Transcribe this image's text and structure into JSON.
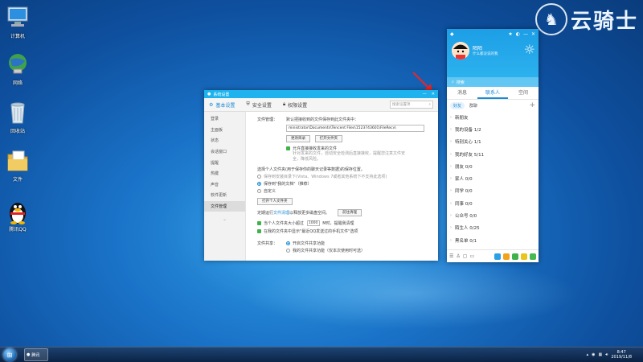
{
  "desktop": {
    "icons": [
      {
        "label": "计算机",
        "icon": "computer-icon"
      },
      {
        "label": "网络",
        "icon": "network-icon"
      },
      {
        "label": "回收站",
        "icon": "recycle-bin-icon"
      },
      {
        "label": "文件",
        "icon": "folder-icon"
      },
      {
        "label": "腾讯QQ",
        "icon": "qq-penguin-icon"
      }
    ]
  },
  "watermark": {
    "text": "云骑士"
  },
  "settings_window": {
    "title": "系统设置",
    "tabs": [
      {
        "label": "基本设置",
        "icon": "gear-icon"
      },
      {
        "label": "安全设置",
        "icon": "shield-icon"
      },
      {
        "label": "权限设置",
        "icon": "lock-icon"
      }
    ],
    "search_placeholder": "搜索设置项",
    "sidebar": [
      "登录",
      "主面板",
      "状态",
      "会话窗口",
      "提醒",
      "热键",
      "声音",
      "软件更新",
      "文件管理"
    ],
    "sidebar_active_index": 8,
    "file_mgmt": {
      "section_label": "文件管理：",
      "save_prompt": "默认把接收到的文件保存到此文件夹中：",
      "path": "ministrator\\Documents\\Tencent Files\\1523743601\\FileRecv\\",
      "btn_change": "更改目录",
      "btn_open": "打开文件夹",
      "auto_download_label": "允许直接接收发来的文件",
      "auto_download_desc": "针对发来的文件，自动安全检测后直接接收，提醒您注意文件安全，降低风险。",
      "location_prompt": "选择个人文件夹(用于保存你的聊天记录等数据)的保存位置。",
      "option_install_dir": "保存到安装目录下(Vista、Windows 7或者其他系统下不支持此选项)",
      "option_my_docs": "保存到\"我的文档\"（推荐）",
      "option_custom": "自定义",
      "btn_open_personal": "打开个人文件夹",
      "cleanup_prompt_before": "定期运行",
      "cleanup_link": "文件清理",
      "cleanup_prompt_after": "以释放更多磁盘空间。",
      "btn_cleanup": "前往清理",
      "size_check_before": "当个人文件夹大小超过",
      "size_value": "1000",
      "size_check_after": "M时，提醒我清理",
      "recent_label": "在我的文件夹中显示\"最近QQ发送过的手机文件\"选项"
    },
    "file_share": {
      "section_label": "文件共享：",
      "option_on": "开启文件共享功能",
      "option_off": "我的文件共享功能（仅本次使用时可选）"
    }
  },
  "qq": {
    "nickname": "陌陌",
    "signature": "什么都没说的我",
    "search_placeholder": "搜索",
    "tabs": [
      "消息",
      "联系人",
      "空间"
    ],
    "active_tab": 1,
    "subtabs": [
      "好友",
      "群聊"
    ],
    "groups": [
      "新朋友",
      "我的设备 1/2",
      "特别关心 1/1",
      "我的好友 5/11",
      "朋友 0/0",
      "家人 0/0",
      "同学 0/0",
      "同事 0/0",
      "公众号 0/0",
      "陌生人 0/25",
      "黑名单 0/1"
    ]
  },
  "taskbar": {
    "item_label": "腾讯",
    "time": "8:47",
    "date": "2019/11/8"
  }
}
